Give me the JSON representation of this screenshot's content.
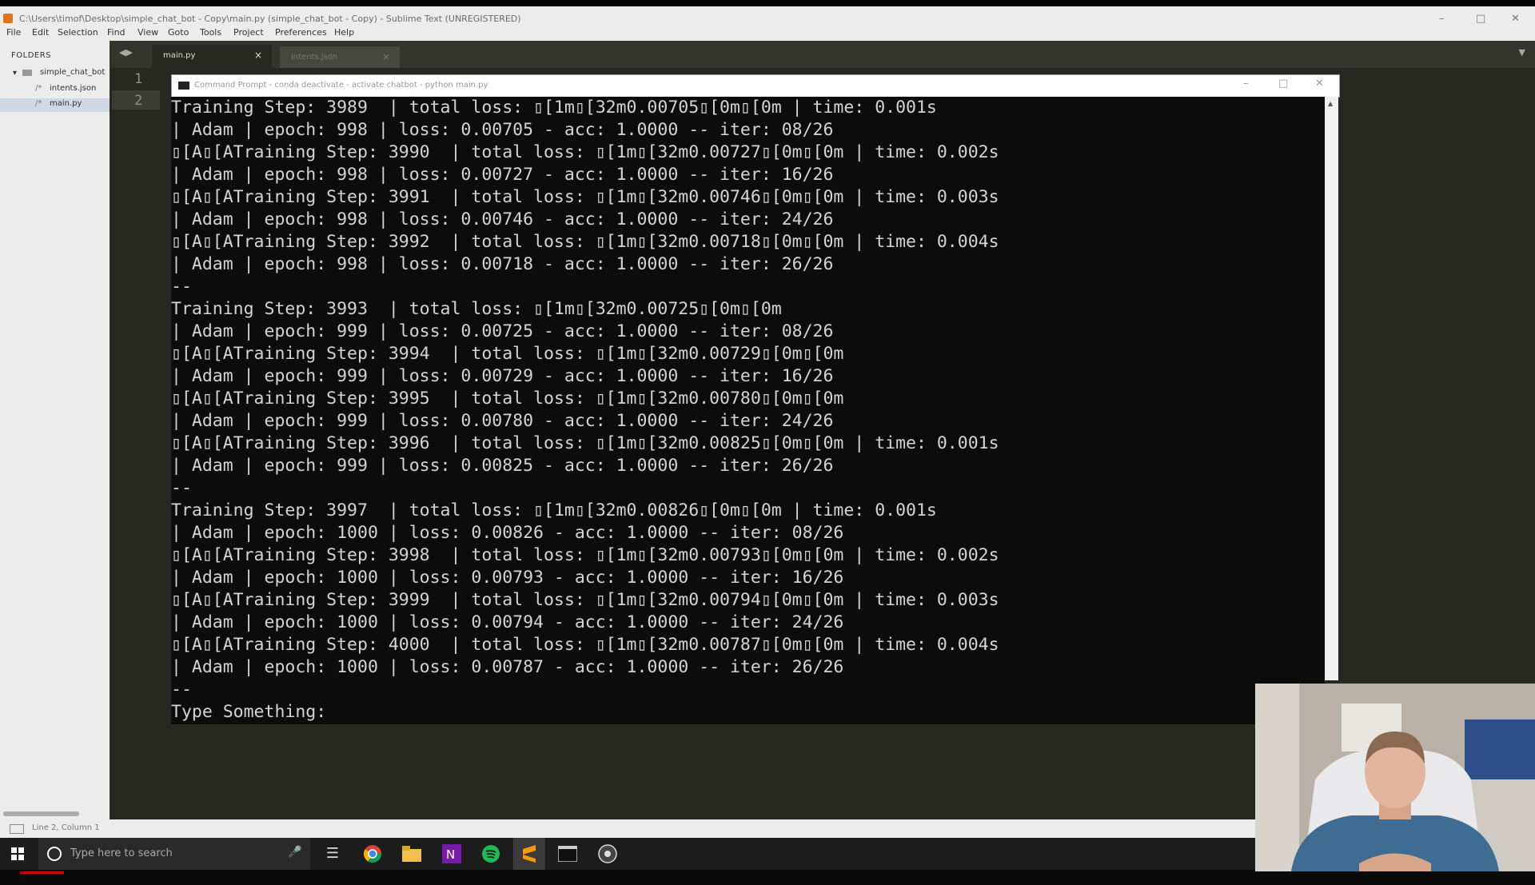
{
  "sublime": {
    "title": "C:\\Users\\timof\\Desktop\\simple_chat_bot - Copy\\main.py (simple_chat_bot - Copy) - Sublime Text (UNREGISTERED)",
    "menu": [
      "File",
      "Edit",
      "Selection",
      "Find",
      "View",
      "Goto",
      "Tools",
      "Project",
      "Preferences",
      "Help"
    ],
    "sidebar": {
      "header": "FOLDERS",
      "folder": "simple_chat_bot",
      "files": [
        "intents.json",
        "main.py"
      ],
      "selected_file": "main.py"
    },
    "tabs": [
      "main.py",
      "intents.json"
    ],
    "line_numbers": [
      "1",
      "2"
    ],
    "status": "Line 2, Column 1"
  },
  "cmd": {
    "title": "Command Prompt - conda  deactivate - activate  chatbot - python  main.py",
    "lines": [
      "Training Step: 3989  | total loss: ▯[1m▯[32m0.00705▯[0m▯[0m | time: 0.001s",
      "| Adam | epoch: 998 | loss: 0.00705 - acc: 1.0000 -- iter: 08/26",
      "▯[A▯[ATraining Step: 3990  | total loss: ▯[1m▯[32m0.00727▯[0m▯[0m | time: 0.002s",
      "| Adam | epoch: 998 | loss: 0.00727 - acc: 1.0000 -- iter: 16/26",
      "▯[A▯[ATraining Step: 3991  | total loss: ▯[1m▯[32m0.00746▯[0m▯[0m | time: 0.003s",
      "| Adam | epoch: 998 | loss: 0.00746 - acc: 1.0000 -- iter: 24/26",
      "▯[A▯[ATraining Step: 3992  | total loss: ▯[1m▯[32m0.00718▯[0m▯[0m | time: 0.004s",
      "| Adam | epoch: 998 | loss: 0.00718 - acc: 1.0000 -- iter: 26/26",
      "--",
      "Training Step: 3993  | total loss: ▯[1m▯[32m0.00725▯[0m▯[0m",
      "| Adam | epoch: 999 | loss: 0.00725 - acc: 1.0000 -- iter: 08/26",
      "▯[A▯[ATraining Step: 3994  | total loss: ▯[1m▯[32m0.00729▯[0m▯[0m",
      "| Adam | epoch: 999 | loss: 0.00729 - acc: 1.0000 -- iter: 16/26",
      "▯[A▯[ATraining Step: 3995  | total loss: ▯[1m▯[32m0.00780▯[0m▯[0m",
      "| Adam | epoch: 999 | loss: 0.00780 - acc: 1.0000 -- iter: 24/26",
      "▯[A▯[ATraining Step: 3996  | total loss: ▯[1m▯[32m0.00825▯[0m▯[0m | time: 0.001s",
      "| Adam | epoch: 999 | loss: 0.00825 - acc: 1.0000 -- iter: 26/26",
      "--",
      "Training Step: 3997  | total loss: ▯[1m▯[32m0.00826▯[0m▯[0m | time: 0.001s",
      "| Adam | epoch: 1000 | loss: 0.00826 - acc: 1.0000 -- iter: 08/26",
      "▯[A▯[ATraining Step: 3998  | total loss: ▯[1m▯[32m0.00793▯[0m▯[0m | time: 0.002s",
      "| Adam | epoch: 1000 | loss: 0.00793 - acc: 1.0000 -- iter: 16/26",
      "▯[A▯[ATraining Step: 3999  | total loss: ▯[1m▯[32m0.00794▯[0m▯[0m | time: 0.003s",
      "| Adam | epoch: 1000 | loss: 0.00794 - acc: 1.0000 -- iter: 24/26",
      "▯[A▯[ATraining Step: 4000  | total loss: ▯[1m▯[32m0.00787▯[0m▯[0m | time: 0.004s",
      "| Adam | epoch: 1000 | loss: 0.00787 - acc: 1.0000 -- iter: 26/26",
      "--",
      "Type Something:"
    ]
  },
  "taskbar": {
    "search_placeholder": "Type here to search",
    "apps": [
      "microphone-icon",
      "task-view-icon",
      "chrome-icon",
      "file-explorer-icon",
      "onenote-icon",
      "spotify-icon",
      "sublime-text-icon",
      "terminal-icon",
      "obs-icon"
    ]
  },
  "colors": {
    "sublime_bg": "#272822",
    "cmd_bg": "#0c0c0c",
    "cmd_text": "#d4d4d4"
  }
}
